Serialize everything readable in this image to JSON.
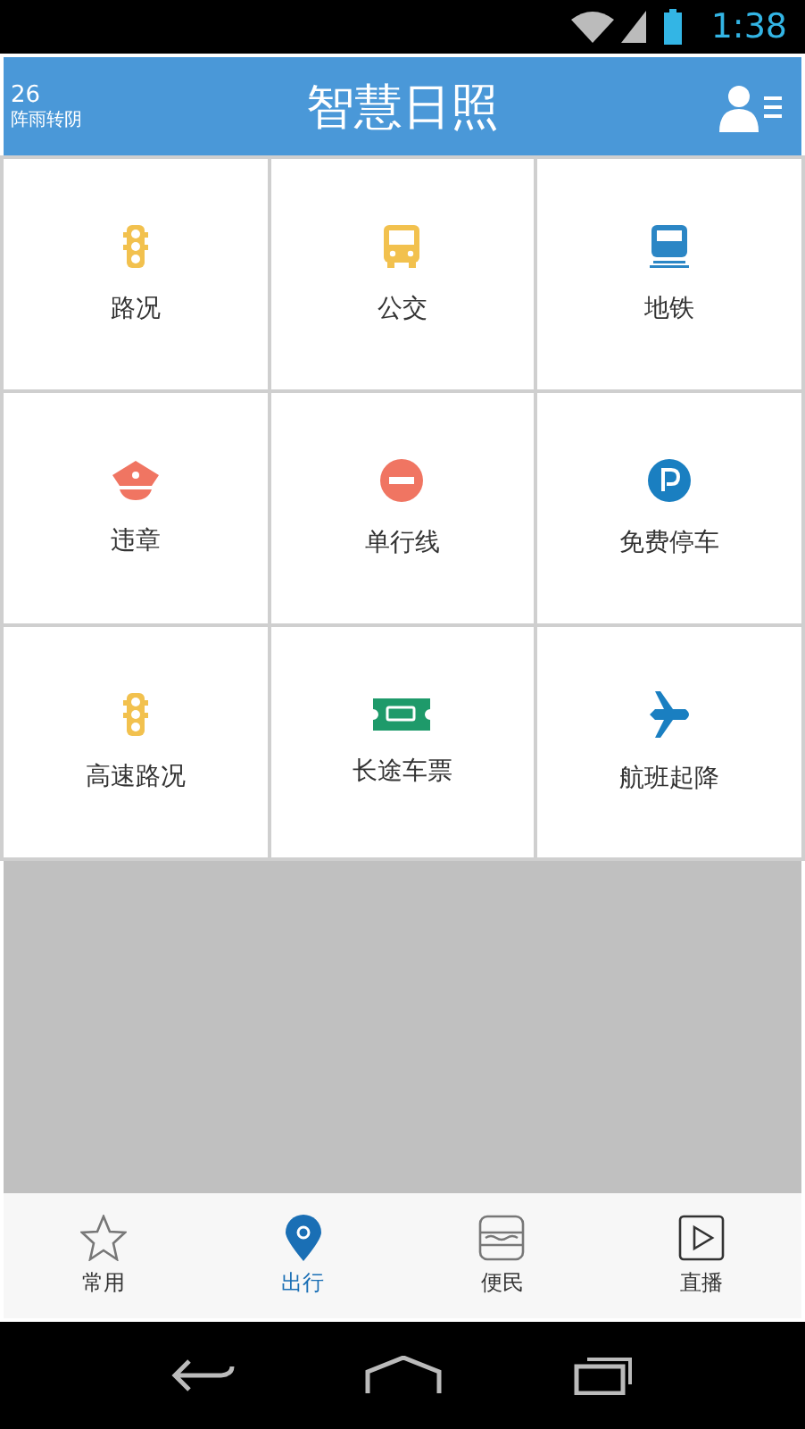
{
  "status_bar": {
    "time": "1:38"
  },
  "header": {
    "temperature": "26",
    "weather": "阵雨转阴",
    "title": "智慧日照"
  },
  "tiles": [
    {
      "label": "路况",
      "kind": "traffic"
    },
    {
      "label": "公交",
      "kind": "bus"
    },
    {
      "label": "地铁",
      "kind": "train"
    },
    {
      "label": "违章",
      "kind": "cap"
    },
    {
      "label": "单行线",
      "kind": "noentry"
    },
    {
      "label": "免费停车",
      "kind": "parking"
    },
    {
      "label": "高速路况",
      "kind": "traffic"
    },
    {
      "label": "长途车票",
      "kind": "ticket"
    },
    {
      "label": "航班起降",
      "kind": "plane"
    }
  ],
  "bottom_nav": [
    {
      "label": "常用",
      "selected": false
    },
    {
      "label": "出行",
      "selected": true
    },
    {
      "label": "便民",
      "selected": false
    },
    {
      "label": "直播",
      "selected": false
    }
  ]
}
